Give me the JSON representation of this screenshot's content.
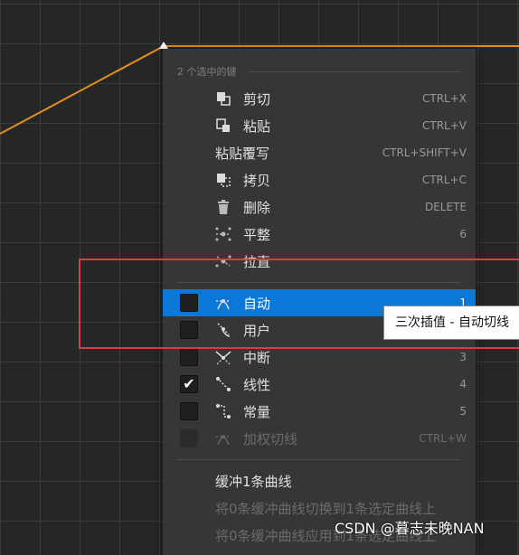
{
  "menu": {
    "header": "2 个选中的键",
    "edit_items": [
      {
        "label": "剪切",
        "shortcut": "CTRL+X",
        "icon": "cut-icon"
      },
      {
        "label": "粘贴",
        "shortcut": "CTRL+V",
        "icon": "paste-icon"
      },
      {
        "label": "粘贴覆写",
        "shortcut": "CTRL+SHIFT+V"
      },
      {
        "label": "拷贝",
        "shortcut": "CTRL+C",
        "icon": "copy-icon"
      },
      {
        "label": "删除",
        "shortcut": "DELETE",
        "icon": "trash-icon"
      },
      {
        "label": "平整",
        "shortcut": "6",
        "icon": "flatten-icon"
      },
      {
        "label": "拉直",
        "shortcut": "",
        "icon": "straighten-icon"
      }
    ],
    "interp_items": [
      {
        "label": "自动",
        "shortcut": "1",
        "checked": false,
        "highlighted": true,
        "icon": "auto-tangent-icon"
      },
      {
        "label": "用户",
        "shortcut": "",
        "checked": false,
        "icon": "user-tangent-icon"
      },
      {
        "label": "中断",
        "shortcut": "3",
        "checked": false,
        "icon": "break-tangent-icon"
      },
      {
        "label": "线性",
        "shortcut": "4",
        "checked": true,
        "icon": "linear-icon"
      },
      {
        "label": "常量",
        "shortcut": "5",
        "checked": false,
        "icon": "constant-icon"
      },
      {
        "label": "加权切线",
        "shortcut": "CTRL+W",
        "checked": false,
        "disabled": true,
        "icon": "weighted-tangent-icon"
      }
    ],
    "buffer_title": "缓冲1条曲线",
    "buffer_swap": "将0条缓冲曲线切换到1条选定曲线上",
    "buffer_apply": "将0条缓冲曲线应用到1条选定曲线上"
  },
  "tooltip": "三次插值 - 自动切线",
  "watermark": "CSDN @暮志未晚NAN",
  "colors": {
    "curve": "#e0901c",
    "highlight": "#0b77d6",
    "annotation_box": "#e03b3b"
  }
}
